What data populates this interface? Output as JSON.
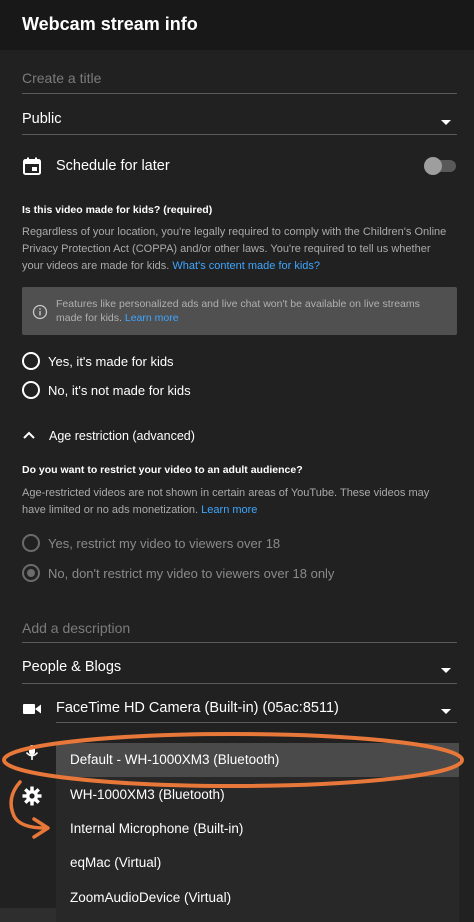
{
  "header": {
    "title": "Webcam stream info"
  },
  "title_field": {
    "placeholder": "Create a title"
  },
  "visibility": {
    "value": "Public"
  },
  "schedule": {
    "label": "Schedule for later",
    "enabled": false
  },
  "kids": {
    "heading": "Is this video made for kids? (required)",
    "body": "Regardless of your location, you're legally required to comply with the Children's Online Privacy Protection Act (COPPA) and/or other laws. You're required to tell us whether your videos are made for kids.",
    "link": "What's content made for kids?",
    "info": "Features like personalized ads and live chat won't be available on live streams made for kids.",
    "info_link": "Learn more",
    "options": [
      "Yes, it's made for kids",
      "No, it's not made for kids"
    ]
  },
  "age": {
    "section_label": "Age restriction (advanced)",
    "heading": "Do you want to restrict your video to an adult audience?",
    "body": "Age-restricted videos are not shown in certain areas of YouTube. These videos may have limited or no ads monetization.",
    "link": "Learn more",
    "options": [
      "Yes, restrict my video to viewers over 18",
      "No, don't restrict my video to viewers over 18 only"
    ]
  },
  "description": {
    "placeholder": "Add a description"
  },
  "category": {
    "value": "People & Blogs"
  },
  "camera": {
    "value": "FaceTime HD Camera (Built-in) (05ac:8511)"
  },
  "microphone": {
    "options": [
      "Default - WH-1000XM3 (Bluetooth)",
      "WH-1000XM3 (Bluetooth)",
      "Internal Microphone (Built-in)",
      "eqMac (Virtual)",
      "ZoomAudioDevice (Virtual)"
    ]
  },
  "colors": {
    "annotation": "#e8773a",
    "link": "#3ea6ff"
  }
}
